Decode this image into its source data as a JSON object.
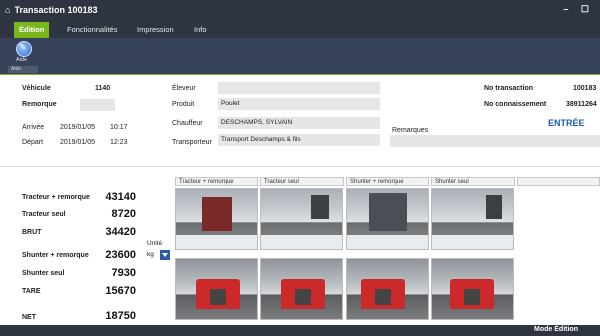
{
  "window": {
    "title": "Transaction 100183",
    "home_icon": "home-icon",
    "controls": "– ☐"
  },
  "menu": {
    "items": [
      "Édition",
      "Fonctionnalités",
      "Impression",
      "Info"
    ]
  },
  "ribbon": {
    "aide_label": "Aide",
    "aide_caption": "Aide"
  },
  "vehicle": {
    "vehicule_label": "Véhicule",
    "vehicule_value": "1140",
    "remorque_label": "Remorque",
    "remorque_value": "",
    "arrivee_label": "Arrivée",
    "arrivee_date": "2019/01/05",
    "arrivee_time": "10:17",
    "depart_label": "Départ",
    "depart_date": "2019/01/05",
    "depart_time": "12:23"
  },
  "details": {
    "eleveur_label": "Éleveur",
    "eleveur_value": "",
    "produit_label": "Produit",
    "produit_value": "Poulet",
    "chauffeur_label": "Chauffeur",
    "chauffeur_value": "DESCHAMPS, SYLVAIN",
    "transporteur_label": "Transporteur",
    "transporteur_value": "Transport Deschamps & fils"
  },
  "transaction": {
    "no_transaction_label": "No transaction",
    "no_transaction_value": "100183",
    "no_connaissement_label": "No connaissement",
    "no_connaissement_value": "38911264",
    "status": "ENTRÉE",
    "remarques_label": "Remarques"
  },
  "weights": {
    "tracteur_remorque_label": "Tracteur + remorque",
    "tracteur_remorque_value": "43140",
    "tracteur_seul_label": "Tracteur seul",
    "tracteur_seul_value": "8720",
    "brut_label": "BRUT",
    "brut_value": "34420",
    "shunter_remorque_label": "Shunter + remorque",
    "shunter_remorque_value": "23600",
    "shunter_seul_label": "Shunter seul",
    "shunter_seul_value": "7930",
    "tare_label": "TARE",
    "tare_value": "15670",
    "net_label": "NET",
    "net_value": "18750"
  },
  "unite": {
    "label": "Unité",
    "value": "kg"
  },
  "cameras": {
    "headers": [
      "Tracteur + remorque",
      "Tracteur seul",
      "Shunter + remorque",
      "Shunter seul"
    ]
  },
  "status_bar": {
    "mode": "Mode Édition"
  },
  "colors": {
    "accent_green": "#7ab51d",
    "dark_bar": "#2f3540",
    "ribbon": "#36425a",
    "entree_blue": "#1f5fb4"
  }
}
